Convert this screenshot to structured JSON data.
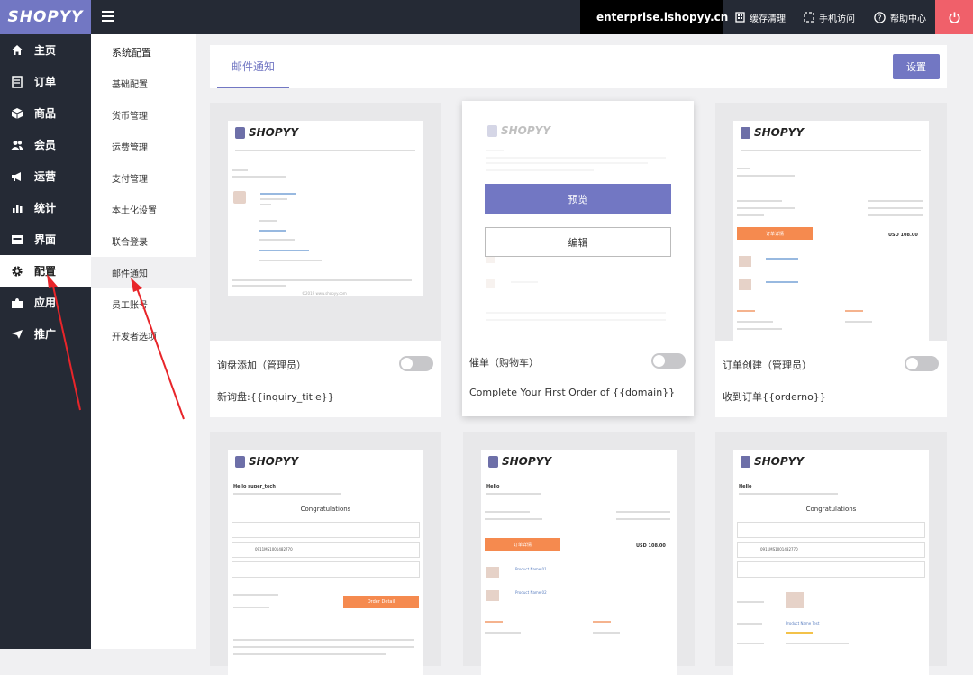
{
  "app": {
    "logo": "SHOPYY",
    "domain": "enterprise.ishopyy.cn"
  },
  "topbar": {
    "items": [
      {
        "label": "缓存清理",
        "icon": "building-icon"
      },
      {
        "label": "手机访问",
        "icon": "mobile-icon"
      },
      {
        "label": "帮助中心",
        "icon": "help-icon"
      }
    ]
  },
  "sidebar": {
    "items": [
      {
        "label": "主页",
        "icon": "home-icon"
      },
      {
        "label": "订单",
        "icon": "order-icon"
      },
      {
        "label": "商品",
        "icon": "box-icon"
      },
      {
        "label": "会员",
        "icon": "users-icon"
      },
      {
        "label": "运营",
        "icon": "megaphone-icon"
      },
      {
        "label": "统计",
        "icon": "bar-chart-icon"
      },
      {
        "label": "界面",
        "icon": "layout-icon"
      },
      {
        "label": "配置",
        "icon": "gear-icon",
        "active": true
      },
      {
        "label": "应用",
        "icon": "puzzle-icon"
      },
      {
        "label": "推广",
        "icon": "send-icon"
      }
    ]
  },
  "submenu": {
    "title": "系统配置",
    "items": [
      "基础配置",
      "货币管理",
      "运费管理",
      "支付管理",
      "本土化设置",
      "联合登录",
      "邮件通知",
      "员工账号",
      "开发者选项"
    ],
    "active_index": 6
  },
  "main": {
    "tab": "邮件通知",
    "settings_button": "设置"
  },
  "cards": [
    {
      "title": "询盘添加（管理员）",
      "subject": "新询盘:{{inquiry_title}}",
      "enabled": false
    },
    {
      "title": "催单（购物车）",
      "subject": "Complete Your First Order of {{domain}}",
      "enabled": false,
      "preview_button": "预览",
      "edit_button": "编辑"
    },
    {
      "title": "订单创建（管理员）",
      "subject": "收到订单{{orderno}}",
      "enabled": false
    },
    {
      "title": "",
      "subject": "",
      "heading": "Congratulations"
    },
    {
      "title": "",
      "subject": ""
    },
    {
      "title": "",
      "subject": "",
      "heading": "Congratulations"
    }
  ],
  "mail_preview": {
    "brand": "SHOPYY",
    "greeting": "Hello",
    "hello2": "Hello super_tech",
    "btn": "Order Detail",
    "btn_cn": "订单详情",
    "total": "USD 108.00",
    "product1": "Product Name Test",
    "product2": "Product Name 01",
    "product3": "Product Name 02",
    "coupon": "0911MS1001482770",
    "footer": "©2019 www.shopyy.com",
    "amount": "USD 108.00"
  },
  "colors": {
    "accent": "#7277c3",
    "topbar": "#252a35",
    "orange": "#f58a4f",
    "power": "#f0606a"
  }
}
